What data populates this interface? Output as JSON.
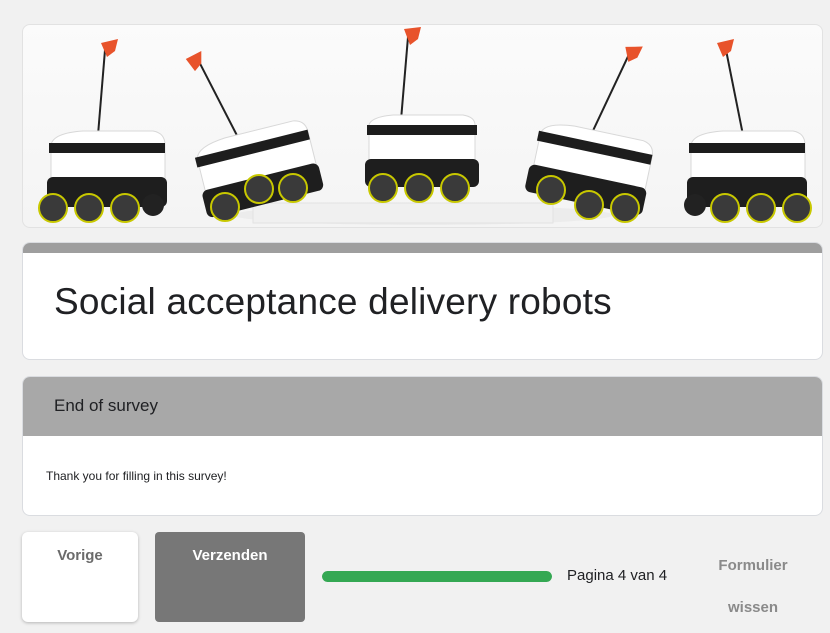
{
  "form": {
    "title": "Social acceptance delivery robots",
    "section_title": "End of survey",
    "section_description": "Thank you for filling in this survey!"
  },
  "navigation": {
    "back_label": "Vorige",
    "submit_label": "Verzenden",
    "page_indicator": "Pagina 4 van 4",
    "progress_fraction": 1.0,
    "clear_label_line1": "Formulier",
    "clear_label_line2": "wissen"
  },
  "colors": {
    "progress": "#34a853",
    "header_bar": "#9e9e9e",
    "section_header": "#a8a8a8",
    "submit_button": "#777777"
  },
  "header_image": {
    "subject": "five delivery robots with orange flags"
  }
}
